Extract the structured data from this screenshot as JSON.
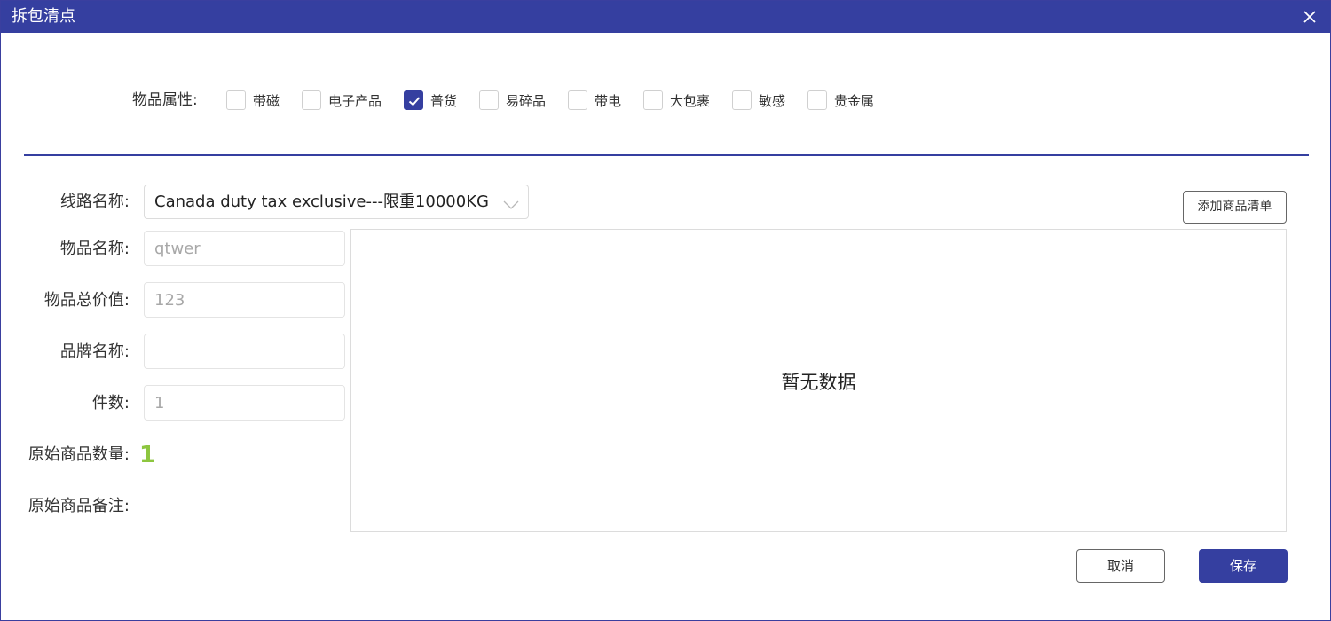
{
  "dialog": {
    "title": "拆包清点"
  },
  "attributes": {
    "label": "物品属性:",
    "options": [
      {
        "label": "带磁",
        "checked": false
      },
      {
        "label": "电子产品",
        "checked": false
      },
      {
        "label": "普货",
        "checked": true
      },
      {
        "label": "易碎品",
        "checked": false
      },
      {
        "label": "带电",
        "checked": false
      },
      {
        "label": "大包裹",
        "checked": false
      },
      {
        "label": "敏感",
        "checked": false
      },
      {
        "label": "贵金属",
        "checked": false
      }
    ]
  },
  "form": {
    "route": {
      "label": "线路名称:",
      "value": "Canada duty tax exclusive---限重10000KG"
    },
    "item_name": {
      "label": "物品名称:",
      "value": "qtwer"
    },
    "total_value": {
      "label": "物品总价值:",
      "value": "123"
    },
    "brand": {
      "label": "品牌名称:",
      "value": ""
    },
    "pieces": {
      "label": "件数:",
      "value": "1"
    },
    "original_qty": {
      "label": "原始商品数量:",
      "value": "1"
    },
    "original_note": {
      "label": "原始商品备注:",
      "value": ""
    }
  },
  "goods_list": {
    "add_button": "添加商品清单",
    "empty_text": "暂无数据"
  },
  "footer": {
    "cancel": "取消",
    "save": "保存"
  },
  "colors": {
    "primary": "#353fa0",
    "quantity_green": "#8dc63f"
  }
}
